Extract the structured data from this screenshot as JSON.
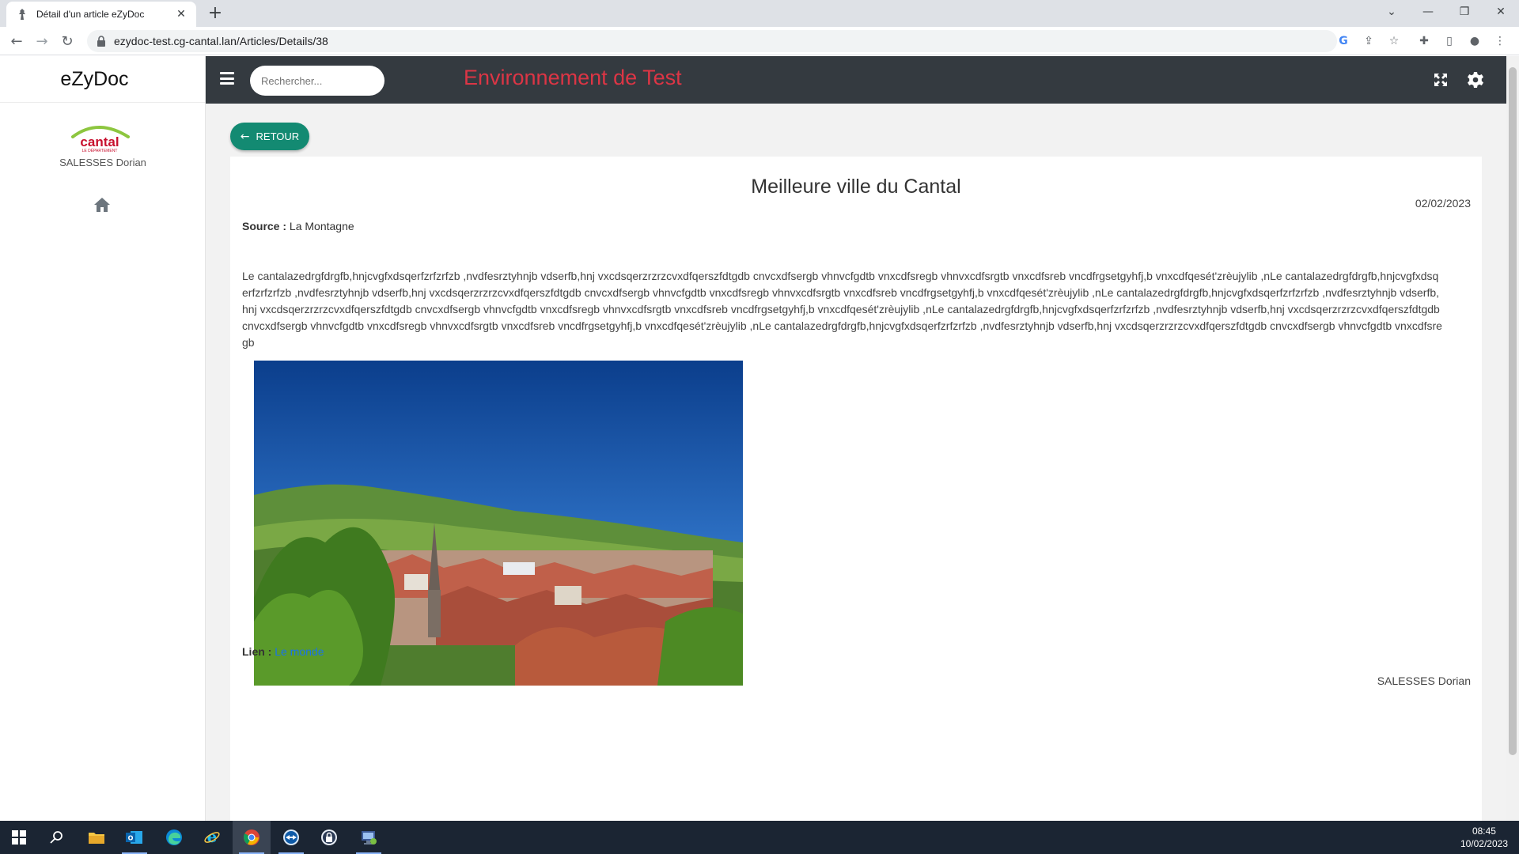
{
  "browser": {
    "tab_title": "Détail d'un article eZyDoc",
    "new_tab_label": "+",
    "url": "ezydoc-test.cg-cantal.lan/Articles/Details/38"
  },
  "app": {
    "brand": "eZyDoc",
    "user_name": "SALESSES Dorian",
    "search_placeholder": "Rechercher...",
    "environment_label": "Environnement de Test",
    "accent_color": "#138a72",
    "env_color": "#dc3545"
  },
  "article": {
    "back_label": "RETOUR",
    "title": "Meilleure ville du Cantal",
    "date": "02/02/2023",
    "source_label": "Source :",
    "source_value": "La Montagne",
    "body": "Le cantalazedrgfdrgfb,hnjcvgfxdsqerfzrfzrfzb ,nvdfesrztyhnjb vdserfb,hnj vxcdsqerzrzrzcvxdfqerszfdtgdb cnvcxdfsergb vhnvcfgdtb vnxcdfsregb vhnvxcdfsrgtb vnxcdfsreb vncdfrgsetgyhfj,b vnxcdfqesét'zrèujylib ,nLe cantalazedrgfdrgfb,hnjcvgfxdsqerfzrfzrfzb ,nvdfesrztyhnjb vdserfb,hnj vxcdsqerzrzrzcvxdfqerszfdtgdb cnvcxdfsergb vhnvcfgdtb vnxcdfsregb vhnvxcdfsrgtb vnxcdfsreb vncdfrgsetgyhfj,b vnxcdfqesét'zrèujylib ,nLe cantalazedrgfdrgfb,hnjcvgfxdsqerfzrfzrfzb ,nvdfesrztyhnjb vdserfb,hnj vxcdsqerzrzrzcvxdfqerszfdtgdb cnvcxdfsergb vhnvcfgdtb vnxcdfsregb vhnvxcdfsrgtb vnxcdfsreb vncdfrgsetgyhfj,b vnxcdfqesét'zrèujylib ,nLe cantalazedrgfdrgfb,hnjcvgfxdsqerfzrfzrfzb ,nvdfesrztyhnjb vdserfb,hnj vxcdsqerzrzrzcvxdfqerszfdtgdb cnvcxdfsergb vhnvcfgdtb vnxcdfsregb vhnvxcdfsrgtb vnxcdfsreb vncdfrgsetgyhfj,b vnxcdfqesét'zrèujylib ,nLe cantalazedrgfdrgfb,hnjcvgfxdsqerfzrfzrfzb ,nvdfesrztyhnjb vdserfb,hnj vxcdsqerzrzrzcvxdfqerszfdtgdb cnvcxdfsergb vhnvcfgdtb vnxcdfsregb",
    "link_label": "Lien :",
    "link_text": "Le monde",
    "author": "SALESSES Dorian"
  },
  "taskbar": {
    "time": "08:45",
    "date": "10/02/2023",
    "apps": [
      "start-icon",
      "search-icon",
      "file-explorer-icon",
      "outlook-icon",
      "edge-icon",
      "internet-explorer-icon",
      "chrome-icon",
      "teamviewer-icon",
      "keepass-icon",
      "remote-desktop-icon"
    ]
  }
}
